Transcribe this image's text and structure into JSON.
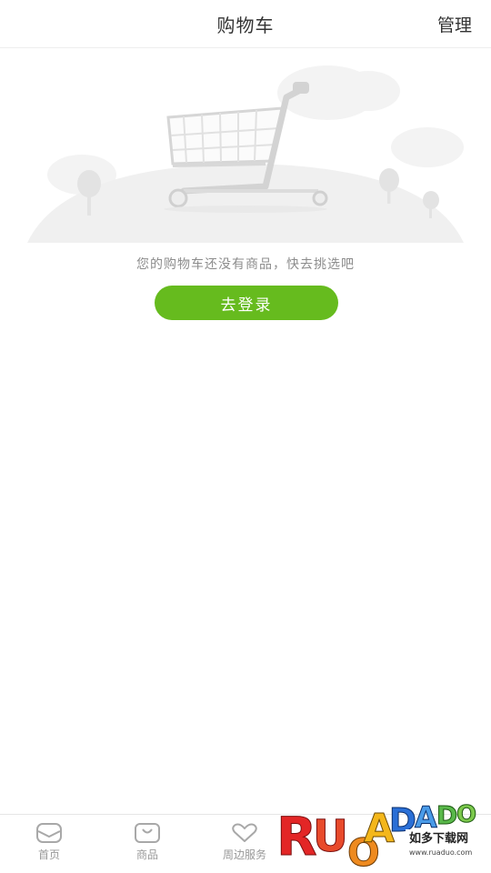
{
  "header": {
    "title": "购物车",
    "manage_label": "管理"
  },
  "empty_state": {
    "illustration_icon": "shopping-cart-illustration",
    "message": "您的购物车还没有商品，快去挑选吧",
    "login_button_label": "去登录",
    "accent_color": "#66bb1e"
  },
  "tabbar": {
    "items": [
      {
        "label": "首页",
        "icon": "home-icon"
      },
      {
        "label": "商品",
        "icon": "bag-icon"
      },
      {
        "label": "周边服务",
        "icon": "heart-icon"
      }
    ]
  },
  "watermark": {
    "brand": "RUANDADO",
    "tagline": "如多下载网",
    "url": "www.ruaduo.com"
  }
}
